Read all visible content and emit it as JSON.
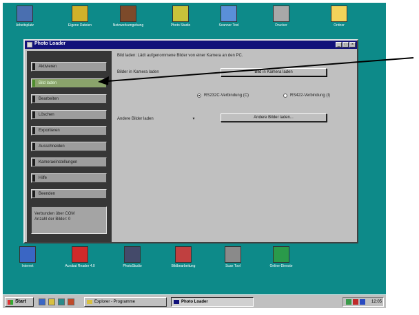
{
  "desktop": {
    "icons_top": [
      {
        "name": "computer-icon",
        "label": "Arbeitsplatz",
        "color": "#4a6fb0"
      },
      {
        "name": "folder-docs-icon",
        "label": "Eigene Dateien",
        "color": "#d1b12a"
      },
      {
        "name": "network-icon",
        "label": "Netzwerkumgebung",
        "color": "#7d4a2a"
      },
      {
        "name": "photo-app-icon",
        "label": "Photo Studio",
        "color": "#c9c23a"
      },
      {
        "name": "scanner-app-icon",
        "label": "Scanner Tool",
        "color": "#5a8fd8"
      },
      {
        "name": "printer-icon",
        "label": "Drucker",
        "color": "#a8a8a8"
      },
      {
        "name": "folder-icon",
        "label": "Ordner",
        "color": "#f2d35a"
      }
    ],
    "icons_bottom": [
      {
        "name": "internet-icon",
        "label": "Internet",
        "color": "#3a66c4"
      },
      {
        "name": "acrobat-icon",
        "label": "Acrobat Reader 4.0",
        "color": "#d02a2a"
      },
      {
        "name": "photo-studio-icon",
        "label": "PhotoStudio",
        "color": "#444a6a"
      },
      {
        "name": "image-expert-icon",
        "label": "Bildbearbeitung",
        "color": "#c04040"
      },
      {
        "name": "scan-tool-icon",
        "label": "Scan Tool",
        "color": "#8a8a8a"
      },
      {
        "name": "connect-icon",
        "label": "Online-Dienste",
        "color": "#2a9a4a"
      }
    ]
  },
  "window": {
    "title": "Photo Loader",
    "controls": {
      "minimize": "_",
      "maximize": "□",
      "close": "×"
    }
  },
  "sidebar": {
    "items": [
      {
        "label": "Aktivieren",
        "active": false
      },
      {
        "label": "Bild laden",
        "active": true
      },
      {
        "label": "Bearbeiten",
        "active": false
      },
      {
        "label": "Löschen",
        "active": false
      },
      {
        "label": "Exportieren",
        "active": false
      },
      {
        "label": "Ausschneiden",
        "active": false
      },
      {
        "label": "Kameraeinstellungen",
        "active": false
      },
      {
        "label": "Hilfe",
        "active": false
      },
      {
        "label": "Beenden",
        "active": false
      }
    ],
    "info_line1": "Verbunden über COM",
    "info_line2": "Anzahl der Bilder: 0"
  },
  "main": {
    "heading": "Bild laden: Lädt aufgenommene Bilder von einer Kamera an den PC.",
    "camera_label": "Bilder in Kamera laden",
    "camera_button": "Bild in Kamera laden",
    "radio1_label": "RS232C-Verbindung (C)",
    "radio2_label": "RS422-Verbindung (I)",
    "other_label": "Andere Bilder laden",
    "dropdown_glyph": "▾",
    "other_button": "Andere Bilder laden..."
  },
  "taskbar": {
    "start_label": "Start",
    "tasks": [
      {
        "label": "Explorer - Programme",
        "pressed": false
      },
      {
        "label": "Photo Loader",
        "pressed": true
      }
    ],
    "clock": "12:05"
  }
}
